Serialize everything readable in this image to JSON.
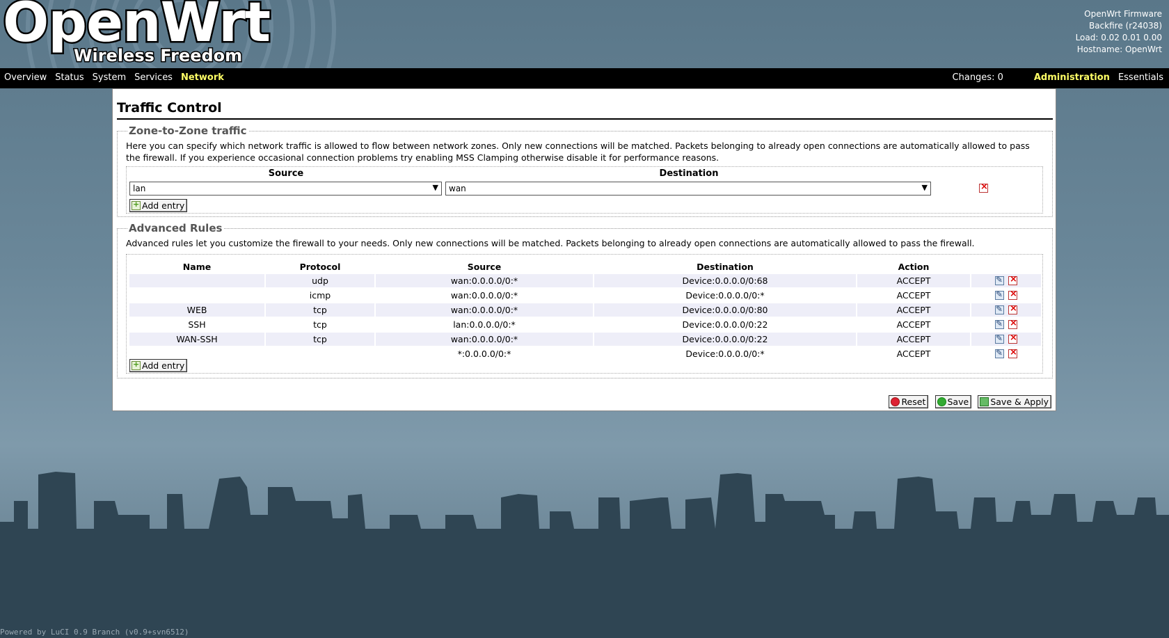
{
  "branding": {
    "logo": "OpenWrt",
    "tagline": "Wireless Freedom"
  },
  "sysinfo": {
    "firmware": "OpenWrt Firmware",
    "version": "Backfire (r24038)",
    "load": "Load: 0.02 0.01 0.00",
    "hostname": "Hostname: OpenWrt"
  },
  "menu": {
    "left": [
      "Overview",
      "Status",
      "System",
      "Services",
      "Network"
    ],
    "active": "Network",
    "changes": "Changes: 0",
    "administration": "Administration",
    "essentials": "Essentials"
  },
  "page": {
    "title": "Traffic Control"
  },
  "zone_section": {
    "legend": "Zone-to-Zone traffic",
    "description_line1": "Here you can specify which network traffic is allowed to flow between network zones. Only new connections will be matched. Packets belonging to already open connections are automatically allowed to pass",
    "description_line2": "the firewall. If you experience occasional connection problems try enabling MSS Clamping otherwise disable it for performance reasons.",
    "col_source": "Source",
    "col_destination": "Destination",
    "source_value": "lan",
    "destination_value": "wan",
    "add_label": "Add entry"
  },
  "rules_section": {
    "legend": "Advanced Rules",
    "description": "Advanced rules let you customize the firewall to your needs. Only new connections will be matched. Packets belonging to already open connections are automatically allowed to pass the firewall.",
    "columns": {
      "name": "Name",
      "protocol": "Protocol",
      "source": "Source",
      "destination": "Destination",
      "action": "Action"
    },
    "rows": [
      {
        "name": "",
        "protocol": "udp",
        "source": "wan:0.0.0.0/0:*",
        "destination": "Device:0.0.0.0/0:68",
        "action": "ACCEPT"
      },
      {
        "name": "",
        "protocol": "icmp",
        "source": "wan:0.0.0.0/0:*",
        "destination": "Device:0.0.0.0/0:*",
        "action": "ACCEPT"
      },
      {
        "name": "WEB",
        "protocol": "tcp",
        "source": "wan:0.0.0.0/0:*",
        "destination": "Device:0.0.0.0/0:80",
        "action": "ACCEPT"
      },
      {
        "name": "SSH",
        "protocol": "tcp",
        "source": "lan:0.0.0.0/0:*",
        "destination": "Device:0.0.0.0/0:22",
        "action": "ACCEPT"
      },
      {
        "name": "WAN-SSH",
        "protocol": "tcp",
        "source": "wan:0.0.0.0/0:*",
        "destination": "Device:0.0.0.0/0:22",
        "action": "ACCEPT"
      },
      {
        "name": "",
        "protocol": "",
        "source": "*:0.0.0.0/0:*",
        "destination": "Device:0.0.0.0/0:*",
        "action": "ACCEPT"
      }
    ],
    "add_label": "Add entry"
  },
  "actions": {
    "reset": "Reset",
    "save": "Save",
    "save_apply": "Save & Apply"
  },
  "footer": "Powered by LuCI 0.9 Branch (v0.9+svn6512)"
}
